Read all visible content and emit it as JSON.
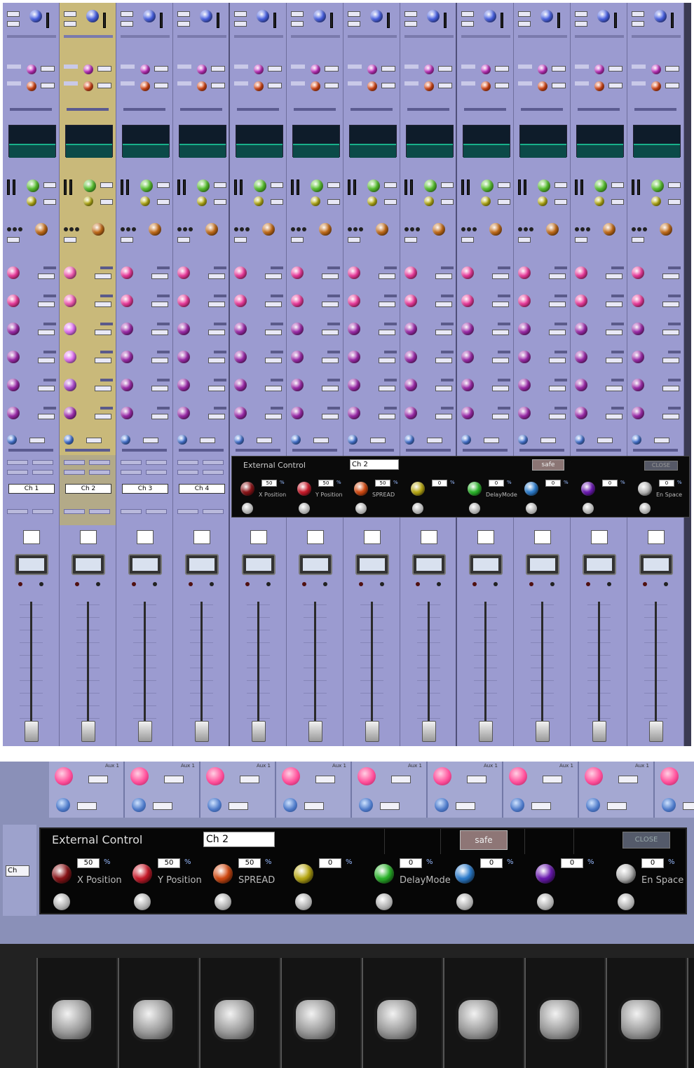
{
  "mixer": {
    "channels": [
      {
        "name": "Ch 1"
      },
      {
        "name": "Ch 2",
        "selected": true
      },
      {
        "name": "Ch 3"
      },
      {
        "name": "Ch 4"
      },
      {
        "name": ""
      },
      {
        "name": ""
      },
      {
        "name": ""
      },
      {
        "name": ""
      },
      {
        "name": ""
      },
      {
        "name": ""
      },
      {
        "name": ""
      },
      {
        "name": ""
      }
    ],
    "colors": {
      "strip": "#9b9bd0",
      "selected_strip": "#c9b97a",
      "eq_screen": "#0e1c2a",
      "panel": "#0a0a0a"
    }
  },
  "external_control": {
    "title": "External Control",
    "channel": "Ch 2",
    "safe_label": "safe",
    "close_label": "CLOSE",
    "params": [
      {
        "label": "X Position",
        "value": "50",
        "unit": "%",
        "color": "#8a1418"
      },
      {
        "label": "Y Position",
        "value": "50",
        "unit": "%",
        "color": "#c81a2a"
      },
      {
        "label": "SPREAD",
        "value": "50",
        "unit": "%",
        "color": "#d24a12"
      },
      {
        "label": "",
        "value": "0",
        "unit": "%",
        "color": "#b8a814"
      },
      {
        "label": "DelayMode",
        "value": "0",
        "unit": "%",
        "color": "#2ab42a"
      },
      {
        "label": "",
        "value": "0",
        "unit": "%",
        "color": "#2c7ccc"
      },
      {
        "label": "",
        "value": "0",
        "unit": "%",
        "color": "#6a1ab0"
      },
      {
        "label": "En Space",
        "value": "0",
        "unit": "%",
        "color": "#b8b8b8"
      }
    ]
  },
  "bottom_photo": {
    "side_tag": "Ch",
    "strip_labels": [
      "Aux 1",
      "Aux 1",
      "Aux 1",
      "Aux 1",
      "Aux 1",
      "Aux 1",
      "Aux 1",
      "Aux 1",
      "Aux 1"
    ]
  }
}
